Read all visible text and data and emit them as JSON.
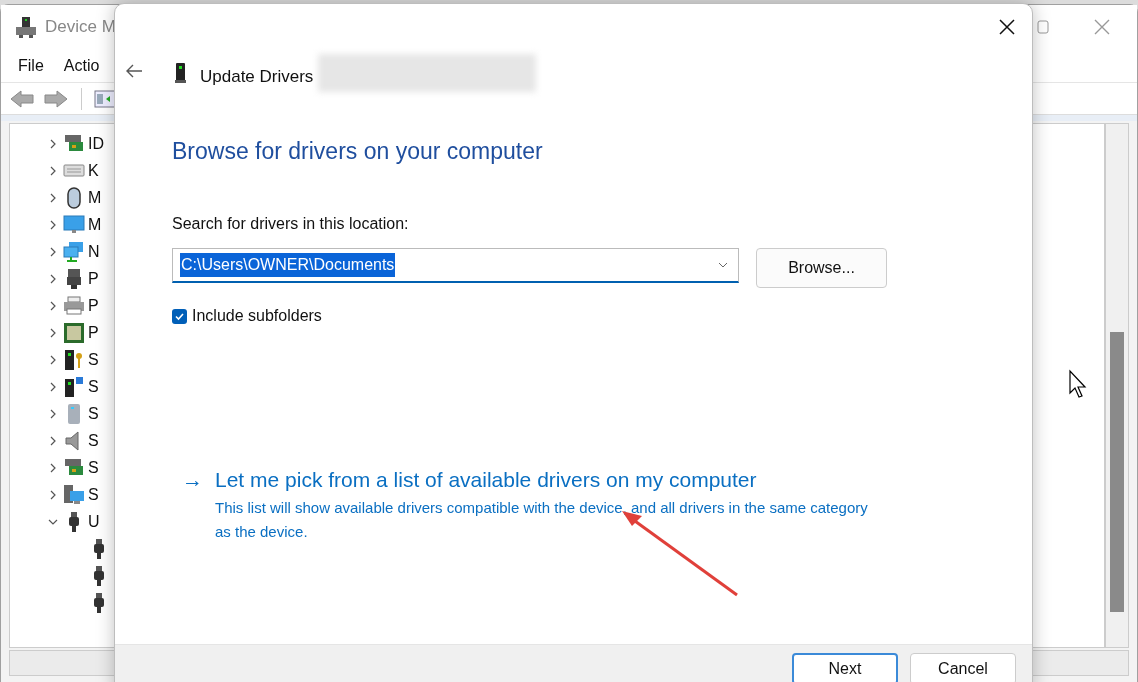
{
  "background_window": {
    "title": "Device M",
    "menu": [
      "File",
      "Actio"
    ],
    "tree": [
      {
        "label": "ID",
        "expanded": false,
        "kind": "ide"
      },
      {
        "label": "K",
        "expanded": false,
        "kind": "keyboard"
      },
      {
        "label": "M",
        "expanded": false,
        "kind": "mouse"
      },
      {
        "label": "M",
        "expanded": false,
        "kind": "monitor"
      },
      {
        "label": "N",
        "expanded": false,
        "kind": "network"
      },
      {
        "label": "P",
        "expanded": false,
        "kind": "port"
      },
      {
        "label": "P",
        "expanded": false,
        "kind": "printer"
      },
      {
        "label": "P",
        "expanded": false,
        "kind": "chip"
      },
      {
        "label": "S",
        "expanded": false,
        "kind": "security"
      },
      {
        "label": "S",
        "expanded": false,
        "kind": "software"
      },
      {
        "label": "S",
        "expanded": false,
        "kind": "storage"
      },
      {
        "label": "S",
        "expanded": false,
        "kind": "sound"
      },
      {
        "label": "S",
        "expanded": false,
        "kind": "ide"
      },
      {
        "label": "S",
        "expanded": false,
        "kind": "system"
      },
      {
        "label": "U",
        "expanded": true,
        "kind": "usb",
        "children": [
          {
            "kind": "usb"
          },
          {
            "kind": "usb"
          },
          {
            "kind": "usb"
          }
        ]
      }
    ]
  },
  "dialog": {
    "title": "Update Drivers",
    "heading": "Browse for drivers on your computer",
    "location_label": "Search for drivers in this location:",
    "location_value": "C:\\Users\\OWNER\\Documents",
    "browse_button": "Browse...",
    "include_subfolders": {
      "label": "Include subfolders",
      "checked": true
    },
    "pick_link": {
      "arrow": "→",
      "label": "Let me pick from a list of available drivers on my computer",
      "description": "This list will show available drivers compatible with the device, and all drivers in the same category as the device."
    },
    "buttons": [
      "Next",
      "Cancel"
    ]
  }
}
